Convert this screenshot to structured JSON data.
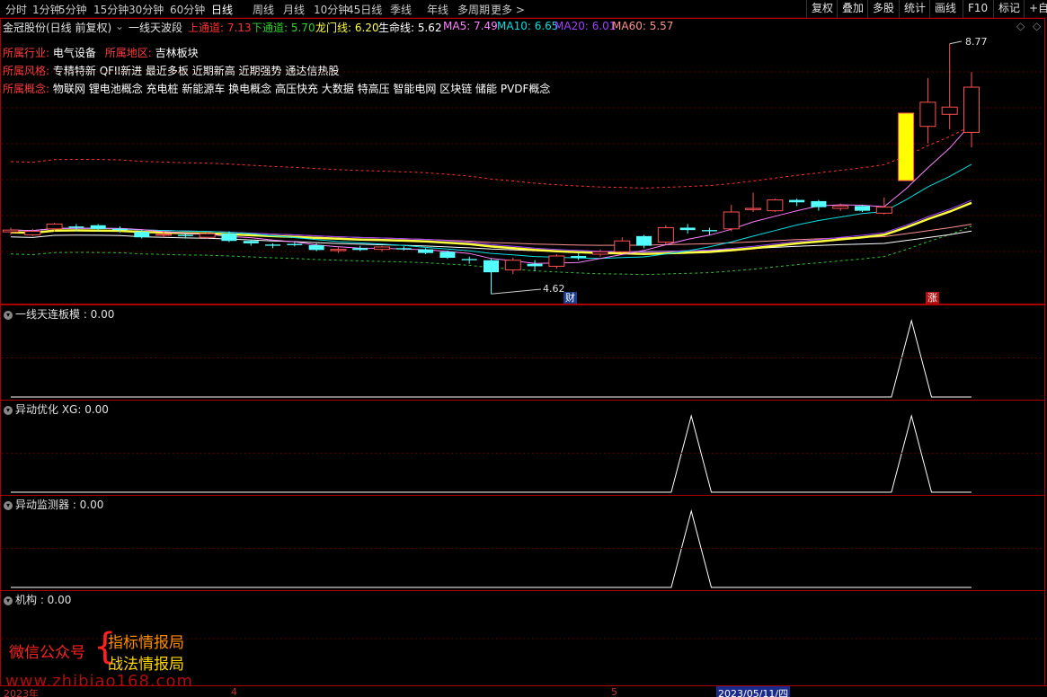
{
  "toolbar": {
    "periods": [
      "分时",
      "1分钟",
      "5分钟",
      "15分钟",
      "30分钟",
      "60分钟",
      "日线",
      "周线",
      "月线",
      "10分钟",
      "45日线",
      "季线",
      "年线",
      "多周期",
      "更多"
    ],
    "active_period": "日线",
    "more_label": "更多 >",
    "right_buttons": [
      "复权",
      "叠加",
      "多股",
      "统计",
      "画线",
      "F10",
      "标记",
      "+自"
    ]
  },
  "title": {
    "stock": "金冠股份(日线 前复权)",
    "indicator": "一线天波段",
    "upper_label": "上通道: 7.13",
    "lower_label": "下通道: 5.70",
    "dragon_label": "龙门线: 6.20",
    "life_label": "生命线: 5.62",
    "ma5": "MA5: 7.49",
    "ma10": "MA10: 6.65",
    "ma20": "MA20: 6.01",
    "ma60": "MA60: 5.57"
  },
  "info": {
    "industry_key": "所属行业:",
    "industry_val": "电气设备",
    "region_key": "所属地区:",
    "region_val": "吉林板块",
    "style_key": "所属风格:",
    "style_val": "专精特新 QFII新进 最近多板 近期新高 近期强势 通达信热股",
    "concept_key": "所属概念:",
    "concept_val": "物联网 锂电池概念 充电桩 新能源车 换电概念 高压快充 大数据 特高压 智能电网 区块链 储能 PVDF概念"
  },
  "price_labels": {
    "high": "8.77",
    "low": "4.62",
    "tag_cai": "财",
    "tag_zhang": "涨"
  },
  "panes": [
    {
      "title": "一线天连板模 : 0.00"
    },
    {
      "title": "异动优化 XG: 0.00"
    },
    {
      "title": "异动监测器 : 0.00"
    },
    {
      "title": "机构 : 0.00"
    }
  ],
  "watermark": {
    "left": "微信公众号",
    "right1": "指标情报局",
    "right2": "战法情报局",
    "url": "www.zhibiao168.com"
  },
  "dates": {
    "d1": "2023年",
    "d2": "4",
    "d3": "5",
    "selected": "2023/05/11/四"
  },
  "colors": {
    "up": "#ff5050",
    "down": "#54ffff",
    "ma5": "#ff80ff",
    "ma10": "#00e0e0",
    "ma20": "#a040ff",
    "dragon": "#ffff40",
    "life": "#ffffff",
    "upper": "#ff3030",
    "lower": "#30c030",
    "ma60": "#ff9090"
  },
  "candles": [
    {
      "o": 5.65,
      "c": 5.68,
      "h": 5.72,
      "l": 5.6
    },
    {
      "o": 5.6,
      "c": 5.66,
      "h": 5.7,
      "l": 5.58
    },
    {
      "o": 5.7,
      "c": 5.78,
      "h": 5.8,
      "l": 5.65
    },
    {
      "o": 5.74,
      "c": 5.72,
      "h": 5.78,
      "l": 5.66
    },
    {
      "o": 5.76,
      "c": 5.7,
      "h": 5.78,
      "l": 5.66
    },
    {
      "o": 5.7,
      "c": 5.68,
      "h": 5.74,
      "l": 5.64
    },
    {
      "o": 5.65,
      "c": 5.56,
      "h": 5.68,
      "l": 5.54
    },
    {
      "o": 5.6,
      "c": 5.61,
      "h": 5.66,
      "l": 5.56
    },
    {
      "o": 5.6,
      "c": 5.58,
      "h": 5.64,
      "l": 5.55
    },
    {
      "o": 5.56,
      "c": 5.62,
      "h": 5.64,
      "l": 5.54
    },
    {
      "o": 5.62,
      "c": 5.5,
      "h": 5.66,
      "l": 5.48
    },
    {
      "o": 5.5,
      "c": 5.46,
      "h": 5.52,
      "l": 5.42
    },
    {
      "o": 5.44,
      "c": 5.42,
      "h": 5.46,
      "l": 5.38
    },
    {
      "o": 5.45,
      "c": 5.43,
      "h": 5.48,
      "l": 5.41
    },
    {
      "o": 5.43,
      "c": 5.35,
      "h": 5.46,
      "l": 5.33
    },
    {
      "o": 5.34,
      "c": 5.36,
      "h": 5.4,
      "l": 5.3
    },
    {
      "o": 5.38,
      "c": 5.35,
      "h": 5.42,
      "l": 5.33
    },
    {
      "o": 5.36,
      "c": 5.4,
      "h": 5.42,
      "l": 5.32
    },
    {
      "o": 5.38,
      "c": 5.36,
      "h": 5.41,
      "l": 5.34
    },
    {
      "o": 5.36,
      "c": 5.3,
      "h": 5.38,
      "l": 5.28
    },
    {
      "o": 5.32,
      "c": 5.22,
      "h": 5.34,
      "l": 5.2
    },
    {
      "o": 5.2,
      "c": 5.18,
      "h": 5.24,
      "l": 5.12
    },
    {
      "o": 5.18,
      "c": 4.98,
      "h": 5.2,
      "l": 4.62
    },
    {
      "o": 5.02,
      "c": 5.18,
      "h": 5.22,
      "l": 4.95
    },
    {
      "o": 5.12,
      "c": 5.08,
      "h": 5.18,
      "l": 5.0
    },
    {
      "o": 5.08,
      "c": 5.25,
      "h": 5.28,
      "l": 5.04
    },
    {
      "o": 5.25,
      "c": 5.22,
      "h": 5.3,
      "l": 5.18
    },
    {
      "o": 5.28,
      "c": 5.32,
      "h": 5.36,
      "l": 5.24
    },
    {
      "o": 5.32,
      "c": 5.5,
      "h": 5.56,
      "l": 5.3
    },
    {
      "o": 5.58,
      "c": 5.42,
      "h": 5.6,
      "l": 5.38
    },
    {
      "o": 5.48,
      "c": 5.72,
      "h": 5.76,
      "l": 5.44
    },
    {
      "o": 5.72,
      "c": 5.68,
      "h": 5.78,
      "l": 5.62
    },
    {
      "o": 5.68,
      "c": 5.66,
      "h": 5.72,
      "l": 5.6
    },
    {
      "o": 5.7,
      "c": 5.98,
      "h": 6.1,
      "l": 5.66
    },
    {
      "o": 6.02,
      "c": 6.04,
      "h": 6.3,
      "l": 5.98
    },
    {
      "o": 6.0,
      "c": 6.18,
      "h": 6.2,
      "l": 5.98
    },
    {
      "o": 6.18,
      "c": 6.14,
      "h": 6.2,
      "l": 6.08
    },
    {
      "o": 6.16,
      "c": 6.06,
      "h": 6.18,
      "l": 6.0
    },
    {
      "o": 6.04,
      "c": 6.08,
      "h": 6.12,
      "l": 6.0
    },
    {
      "o": 6.08,
      "c": 6.0,
      "h": 6.1,
      "l": 5.98
    },
    {
      "o": 5.96,
      "c": 6.06,
      "h": 6.22,
      "l": 5.94
    },
    {
      "o": 6.5,
      "c": 7.62,
      "h": 7.62,
      "l": 6.5,
      "limit": true
    },
    {
      "o": 7.4,
      "c": 7.8,
      "h": 8.2,
      "l": 7.12
    },
    {
      "o": 7.6,
      "c": 7.72,
      "h": 8.77,
      "l": 7.35
    },
    {
      "o": 7.3,
      "c": 8.05,
      "h": 8.3,
      "l": 7.05
    }
  ],
  "indicator_series": {
    "pane1": [
      0,
      0,
      0,
      0,
      0,
      0,
      0,
      0,
      0,
      0,
      0,
      0,
      0,
      0,
      0,
      0,
      0,
      0,
      0,
      0,
      0,
      0,
      0,
      0,
      0,
      0,
      0,
      0,
      0,
      0,
      0,
      0,
      0,
      0,
      0,
      0,
      0,
      0,
      0,
      0,
      0,
      0,
      0,
      0,
      0,
      1,
      0,
      0,
      0
    ],
    "pane2": [
      0,
      0,
      0,
      0,
      0,
      0,
      0,
      0,
      0,
      0,
      0,
      0,
      0,
      0,
      0,
      0,
      0,
      0,
      0,
      0,
      0,
      0,
      0,
      0,
      0,
      0,
      0,
      0,
      0,
      0,
      0,
      0,
      0,
      0,
      1,
      0,
      0,
      0,
      0,
      0,
      0,
      0,
      0,
      0,
      0,
      1,
      0,
      0,
      0
    ],
    "pane3": [
      0,
      0,
      0,
      0,
      0,
      0,
      0,
      0,
      0,
      0,
      0,
      0,
      0,
      0,
      0,
      0,
      0,
      0,
      0,
      0,
      0,
      0,
      0,
      0,
      0,
      0,
      0,
      0,
      0,
      0,
      0,
      0,
      0,
      0,
      1,
      0,
      0,
      0,
      0,
      0,
      0,
      0,
      0,
      0,
      0,
      0,
      0,
      0,
      0
    ]
  }
}
